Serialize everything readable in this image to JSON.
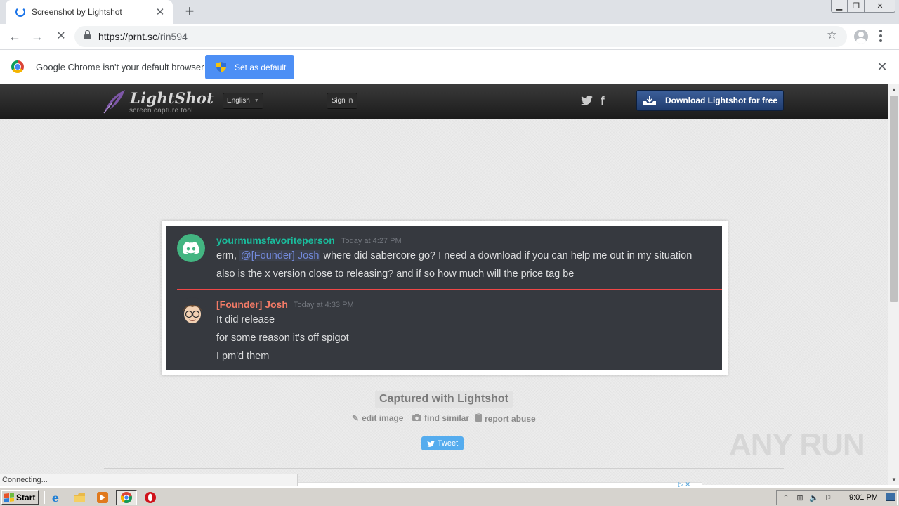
{
  "browser": {
    "tab_title": "Screenshot by Lightshot",
    "url_host": "https://prnt.sc",
    "url_path": "/rin594",
    "infobar_text": "Google Chrome isn't your default browser",
    "set_default_label": "Set as default"
  },
  "lightshot": {
    "logo_title": "LightShot",
    "logo_subtitle": "screen capture tool",
    "language": "English",
    "signin_label": "Sign in",
    "download_label": "Download Lightshot for free",
    "captured_label": "Captured with Lightshot",
    "actions": {
      "edit": "edit image",
      "similar": "find similar",
      "report": "report abuse"
    },
    "tweet_label": "Tweet"
  },
  "screenshot": {
    "messages": [
      {
        "author": "yourmumsfavoriteperson",
        "author_color": "#1abc9c",
        "time": "Today at 4:27 PM",
        "line1_prefix": "erm,",
        "line1_mention": "@[Founder] Josh",
        "line1_suffix": "where did sabercore go? I need a download if you can help me out in my situation",
        "line2": "also is the x version close to releasing? and if so how much will the price tag be"
      },
      {
        "author": "[Founder] Josh",
        "author_color": "#f47b67",
        "time": "Today at 4:33 PM",
        "lines": [
          "It did release",
          "for some reason it's off spigot",
          "I pm'd them"
        ]
      }
    ]
  },
  "watermark": "ANY RUN",
  "status_text": "Connecting...",
  "taskbar": {
    "start_label": "Start",
    "clock": "9:01 PM"
  },
  "colors": {
    "chrome_blue": "#4d8ff5",
    "discord_bg": "#36393f",
    "mention": "#7289da",
    "divider_red": "#f04747"
  }
}
